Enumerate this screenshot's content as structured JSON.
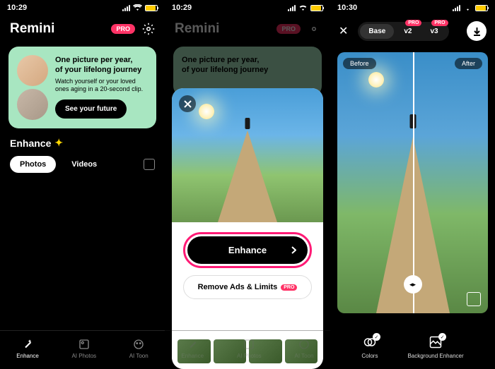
{
  "screen1": {
    "status_time": "10:29",
    "app_name": "Remini",
    "pro_label": "PRO",
    "promo": {
      "title_l1": "One picture per year,",
      "title_l2": "of your lifelong journey",
      "subtitle": "Watch yourself or your loved ones aging in a 20-second clip.",
      "cta": "See your future"
    },
    "section_title": "Enhance",
    "tabs": {
      "photos": "Photos",
      "videos": "Videos"
    },
    "nav": {
      "enhance": "Enhance",
      "ai_photos": "AI Photos",
      "ai_toon": "AI Toon"
    }
  },
  "screen2": {
    "status_time": "10:29",
    "app_name": "Remini",
    "pro_label": "PRO",
    "promo": {
      "title_l1": "One picture per year,",
      "title_l2": "of your lifelong journey"
    },
    "sheet": {
      "enhance_label": "Enhance",
      "remove_label": "Remove Ads & Limits",
      "remove_badge": "PRO"
    },
    "nav": {
      "enhance": "Enhance",
      "ai_photos": "AI Photos",
      "ai_toon": "AI Toon"
    }
  },
  "screen3": {
    "status_time": "10:30",
    "modes": {
      "base": "Base",
      "v2": "v2",
      "v3": "v3",
      "pro": "PRO"
    },
    "labels": {
      "before": "Before",
      "after": "After"
    },
    "nav": {
      "colors": "Colors",
      "bg": "Background Enhancer"
    }
  }
}
